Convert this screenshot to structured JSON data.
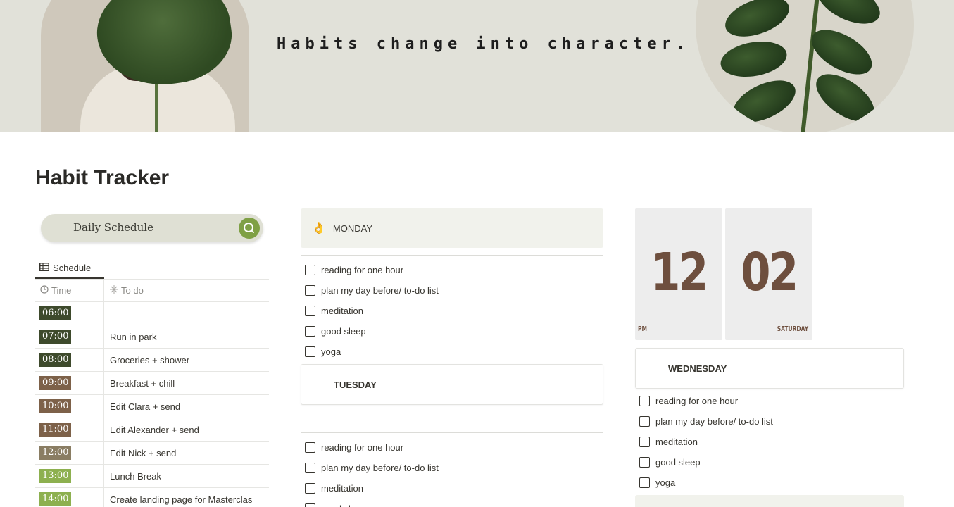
{
  "banner": {
    "tagline": "Habits change into character."
  },
  "page": {
    "title": "Habit Tracker"
  },
  "schedule": {
    "search_label": "Daily Schedule",
    "view_tab": "Schedule",
    "columns": {
      "time": "Time",
      "todo": "To do"
    },
    "rows": [
      {
        "time": "06:00",
        "todo": "",
        "color": "#3e4a2c"
      },
      {
        "time": "07:00",
        "todo": "Run in park",
        "color": "#3e4a2c"
      },
      {
        "time": "08:00",
        "todo": "Groceries + shower",
        "color": "#3e4a2c"
      },
      {
        "time": "09:00",
        "todo": "Breakfast + chill",
        "color": "#7d6149"
      },
      {
        "time": "10:00",
        "todo": "Edit Clara + send",
        "color": "#7d6149"
      },
      {
        "time": "11:00",
        "todo": "Edit Alexander + send",
        "color": "#7d6149"
      },
      {
        "time": "12:00",
        "todo": "Edit Nick + send",
        "color": "#8a7d63"
      },
      {
        "time": "13:00",
        "todo": "Lunch Break",
        "color": "#8db04f"
      },
      {
        "time": "14:00",
        "todo": "Create landing page for Masterclas",
        "color": "#8db04f"
      }
    ]
  },
  "monday": {
    "icon": "👌",
    "label": "MONDAY",
    "habits": [
      "reading for one hour",
      "plan my day before/ to-do list",
      "meditation",
      "good sleep",
      "yoga"
    ]
  },
  "tuesday": {
    "label": "TUESDAY",
    "habits": [
      "reading for one hour",
      "plan my day before/ to-do list",
      "meditation",
      "good sleep"
    ]
  },
  "clock": {
    "hour": "12",
    "minute": "02",
    "period": "PM",
    "day": "SATURDAY"
  },
  "wednesday": {
    "label": "WEDNESDAY",
    "habits": [
      "reading for one hour",
      "plan my day before/ to-do list",
      "meditation",
      "good sleep",
      "yoga"
    ]
  }
}
